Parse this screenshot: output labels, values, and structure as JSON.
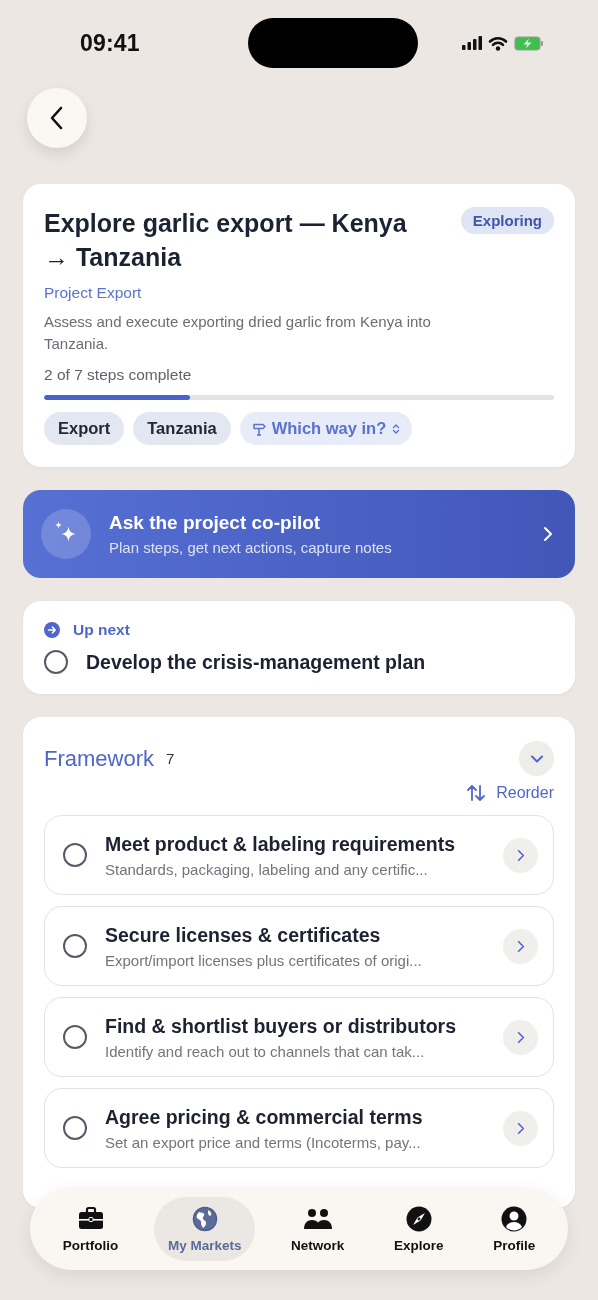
{
  "status_bar": {
    "time": "09:41"
  },
  "project": {
    "title": "Explore garlic export — Kenya → Tanzania",
    "status": "Exploring",
    "category": "Project Export",
    "description": "Assess and execute exporting dried garlic from Kenya into Tanzania.",
    "progress_text": "2 of 7 steps complete",
    "level": 0.2857,
    "tags": [
      {
        "kind": "tag",
        "label": "Export"
      },
      {
        "kind": "tag",
        "label": "Tanzania"
      },
      {
        "kind": "picker",
        "label": "Which way in?"
      }
    ]
  },
  "copilot": {
    "title": "Ask the project co-pilot",
    "subtitle": "Plan steps, get next actions, capture notes"
  },
  "up_next": {
    "label": "Up next",
    "task": "Develop the crisis-management plan",
    "checked": false
  },
  "framework": {
    "title": "Framework",
    "count": "7",
    "expanded": true,
    "reorder": "Reorder",
    "steps": [
      {
        "title": "Meet product & labeling requirements",
        "summary": "Standards, packaging, labeling and any certific...",
        "checked": false
      },
      {
        "title": "Secure licenses & certificates",
        "summary": "Export/import licenses plus certificates of origi...",
        "checked": false
      },
      {
        "title": "Find & shortlist buyers or distributors",
        "summary": "Identify and reach out to channels that can tak...",
        "checked": false
      },
      {
        "title": "Agree pricing & commercial terms",
        "summary": "Set an export price and terms (Incoterms, pay...",
        "checked": false
      }
    ]
  },
  "tab_bar": [
    {
      "label": "Portfolio",
      "kind": "briefcase",
      "selected": false
    },
    {
      "label": "My Markets",
      "kind": "globe",
      "selected": true
    },
    {
      "label": "Network",
      "kind": "people",
      "selected": false
    },
    {
      "label": "Explore",
      "kind": "compass",
      "selected": false
    },
    {
      "label": "Profile",
      "kind": "person",
      "selected": false
    }
  ]
}
